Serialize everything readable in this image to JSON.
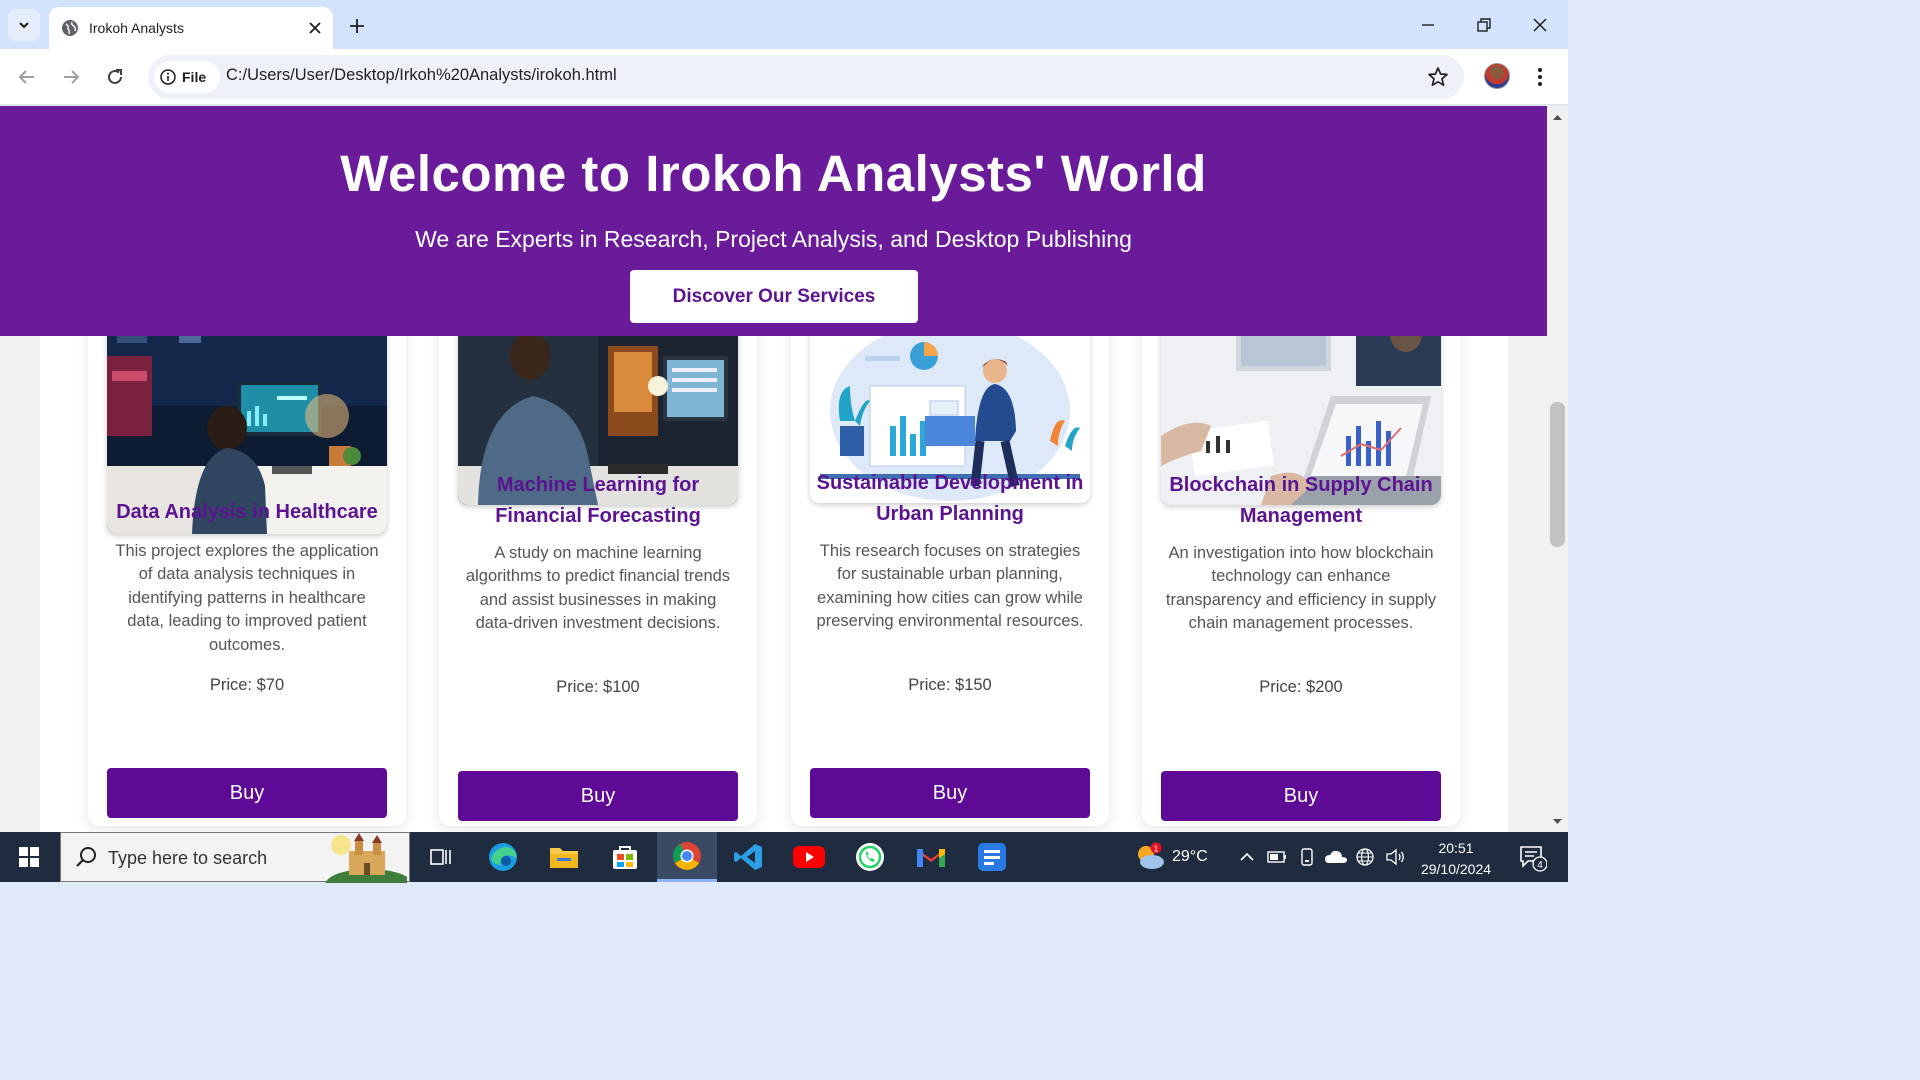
{
  "browser": {
    "tab_title": "Irokoh Analysts",
    "site_info_label": "File",
    "url": "C:/Users/User/Desktop/Irkoh%20Analysts/irokoh.html"
  },
  "hero": {
    "title": "Welcome to Irokoh Analysts' World",
    "subtitle": "We are Experts in Research, Project Analysis, and Desktop Publishing",
    "cta_label": "Discover Our Services"
  },
  "projects": [
    {
      "title": "Data Analysis in Healthcare",
      "description": "This project explores the application of data analysis techniques in identifying patterns in healthcare data, leading to improved patient outcomes.",
      "price": "Price: $70",
      "buy_label": "Buy"
    },
    {
      "title": "Machine Learning for Financial Forecasting",
      "description": "A study on machine learning algorithms to predict financial trends and assist businesses in making data-driven investment decisions.",
      "price": "Price: $100",
      "buy_label": "Buy"
    },
    {
      "title": "Sustainable Development in Urban Planning",
      "description": "This research focuses on strategies for sustainable urban planning, examining how cities can grow while preserving environmental resources.",
      "price": "Price: $150",
      "buy_label": "Buy"
    },
    {
      "title": "Blockchain in Supply Chain Management",
      "description": "An investigation into how blockchain technology can enhance transparency and efficiency in supply chain management processes.",
      "price": "Price: $200",
      "buy_label": "Buy"
    }
  ],
  "taskbar": {
    "search_placeholder": "Type here to search",
    "weather_temp": "29°C",
    "weather_badge": "1",
    "time": "20:51",
    "date": "29/10/2024",
    "notification_count": "4",
    "pinned_apps": [
      "task-view",
      "edge",
      "file-explorer",
      "microsoft-store",
      "chrome",
      "vscode",
      "youtube",
      "whatsapp",
      "gmail",
      "docs"
    ]
  },
  "colors": {
    "hero_bg": "#6a1b9a",
    "brand_purple": "#5b1391",
    "button_purple": "#5f0a96",
    "tabbar_bg": "#d3e3fd",
    "taskbar_bg": "#1f2b3e"
  }
}
